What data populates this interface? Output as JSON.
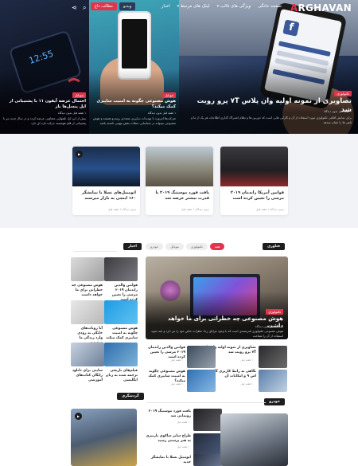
{
  "brand": {
    "name_pre": "A",
    "name_rest": "RGHAVAN",
    "accent": "#e4344b"
  },
  "nav": {
    "menu": [
      "صفحه خانگی",
      "ویژگی های قالب",
      "لینک های مرتبط",
      "اخبار"
    ],
    "hot": [
      "مطالب داغ",
      "ویدیو"
    ],
    "icons": [
      "search-icon",
      "share-icon"
    ]
  },
  "hero": {
    "main": {
      "category": "تکنولوژی",
      "title": "تصاویری از نمونه اولیه وان پلاس ۷T پرو رویت شد",
      "meta": "۱ هفته قبل   بدون دیدگاه",
      "excerpt": "برای نمایش افکتی تکنولوژی مورد استفاده از آن و کارایی هایی است که دوربین ها و نظام اشتراک گذاری اطلاعات هر یک از ما و تلفن ها را نشان میدهد"
    },
    "middle": {
      "category": "موبایل",
      "title": "هوش مصنوعی چگونه به امنیت سایبری کمک میکند؟",
      "meta": "۱ هفته قبل   بدون دیدگاه",
      "excerpt": "شرکت‌ها امروزه با تهدیدات سایبری متعددی روبه‌رو هستند و هوش مصنوعی میتواند در شناسایی حملات نقش مهمی داشته باشد"
    },
    "left": {
      "category": "موبایل",
      "title": "احتمال عرضه آیفون ۱۱ با پشتیبانی از اپل پنسل‌ها‌ باز",
      "meta": "۱ هفته قبل   بدون دیدگاه",
      "excerpt": "پیش از این اپل تلفنهایی متفاوتی عرضه کرده و در سال جدید نیز با پشتیبانی از قلم هوشمند حرکت تازه ای دارد"
    }
  },
  "featured": [
    {
      "title": "اتومبیل‌های تسلا با نمایشگر ۱۶۰ اینچی به بازار میرسند",
      "meta": "بدون دیدگاه   ۱ هفته قبل",
      "play": true
    },
    {
      "title": "یافت فورد موستنگ ۲۰۱۹ با قدرت بیشتر عرضه شد",
      "meta": "بدون دیدگاه   ۱ هفته قبل",
      "play": false
    },
    {
      "title": "قوانین آمریکا راندمان ۲۰۱۹ مرسی را تعیین کرده است",
      "meta": "بدون دیدگاه   ۱ هفته قبل",
      "play": false
    }
  ],
  "section1": {
    "tag": "فناوری",
    "tabs": [
      "همه",
      "تکنولوژی",
      "موبایل",
      "خودرو"
    ],
    "side_tag": "اخبار",
    "big": {
      "category": "تکنولوژی",
      "title": "هوش مصنوعی چه خطراتی برای ما خواهد داشت",
      "meta": "۱ هفته قبل   بدون دیدگاه",
      "excerpt": "هوش مصنوعی تکنولوژی قدرتمندی است که با وجود مزایای زیاد خطرات خاص خود را نیز دارد و باید نحوه استفاده از آن را شناخت"
    },
    "list": [
      {
        "title": "قوانین والدین راندمان ۲۰۱۹ مرسی را تعیین کرده است",
        "meta": "۱ هفته قبل"
      },
      {
        "title": "تصاویری از نمونه اولیه وان پلاس ۷T پرو رویت شد",
        "meta": "۱ هفته قبل"
      },
      {
        "title": "هوش مصنوعی چگونه به امنیت سایبری کمک میکند؟",
        "meta": "۱ هفته قبل"
      },
      {
        "title": "نگاهی به رابط کاربری گلکسی اس ۹ و امکانات آن",
        "meta": "۱ هفته قبل"
      }
    ],
    "side": [
      {
        "title": "قوانین والدین راندمان ۲۰۱۹ مرسی را تعیین کرده است",
        "meta": "۱ هفته قبل"
      },
      {
        "title": "هوش مصنوعی چه خطراتی برای ما خواهد داشت",
        "meta": "۱ هفته قبل"
      },
      {
        "title": "هوش مصنوعی چگونه به امنیت سایبری کمک میکند",
        "meta": "۱ هفته قبل"
      },
      {
        "title": "آیا روبات‌های خانگی به زودی وارد زندگی ما میشوند",
        "meta": "۱ هفته قبل"
      },
      {
        "title": "فیلم‌های تاریخی ترجمه شده به زبان انگلیسی",
        "meta": "۱ هفته قبل"
      },
      {
        "title": "سایتی برای دانلود رایگان کتاب‌های آموزشی",
        "meta": "۱ هفته قبل"
      }
    ]
  },
  "section2": {
    "tag_left": "گردشگری",
    "tag_right": "خودرو",
    "list": [
      {
        "title": "یافت فورد موستنگ ۲۰۱۹ رونمایی شد",
        "meta": "۱ هفته قبل"
      },
      {
        "title": "طراح سایز ساکوی پارتیزی به هنر پرستی رسید",
        "meta": "۱ هفته قبل"
      },
      {
        "title": "اتومبیل تسلا با نمایشگر جدید",
        "meta": "۱ هفته قبل"
      }
    ]
  }
}
